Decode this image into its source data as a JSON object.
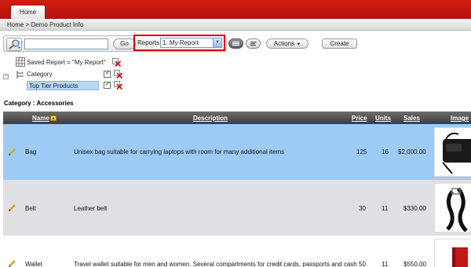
{
  "tabs": [
    {
      "label": "Home"
    }
  ],
  "breadcrumb": "Home  >  Demo Product Info",
  "toolbar": {
    "search_value": "",
    "go_label": "Go",
    "reports_label": "Reports",
    "reports_selected": "1. My Report",
    "actions_label": "Actions",
    "create_label": "Create"
  },
  "filters": {
    "saved_report": "Saved Report = \"My Report\"",
    "category": "Category",
    "top_tier": "Top Tier Products"
  },
  "category_title": "Category : Accessories",
  "table": {
    "columns": [
      "Name",
      "Description",
      "Price",
      "Units",
      "Sales",
      "Image"
    ],
    "rows": [
      {
        "name": "Bag",
        "description": "Unisex bag suitable for carrying laptops with room for many additional items",
        "price": "125",
        "units": "16",
        "sales": "$2,000.00"
      },
      {
        "name": "Belt",
        "description": "Leather belt",
        "price": "30",
        "units": "11",
        "sales": "$330.00"
      },
      {
        "name": "Wallet",
        "description": "Travel wallet suitable for men and women. Several compartments for credit cards, passports and cash",
        "price": "50",
        "units": "11",
        "sales": "$550.00"
      }
    ]
  },
  "colors": {
    "brand_red": "#c4170d",
    "selected_row": "#9ecbf6",
    "alt_row": "#e0dfe3"
  },
  "icons": [
    "search-icon",
    "view-icon-icon",
    "view-report-icon",
    "actions-chevron-icon",
    "grid-icon",
    "tree-icon",
    "delete-filter-icon",
    "edit-icon",
    "sort-ascending-icon"
  ]
}
